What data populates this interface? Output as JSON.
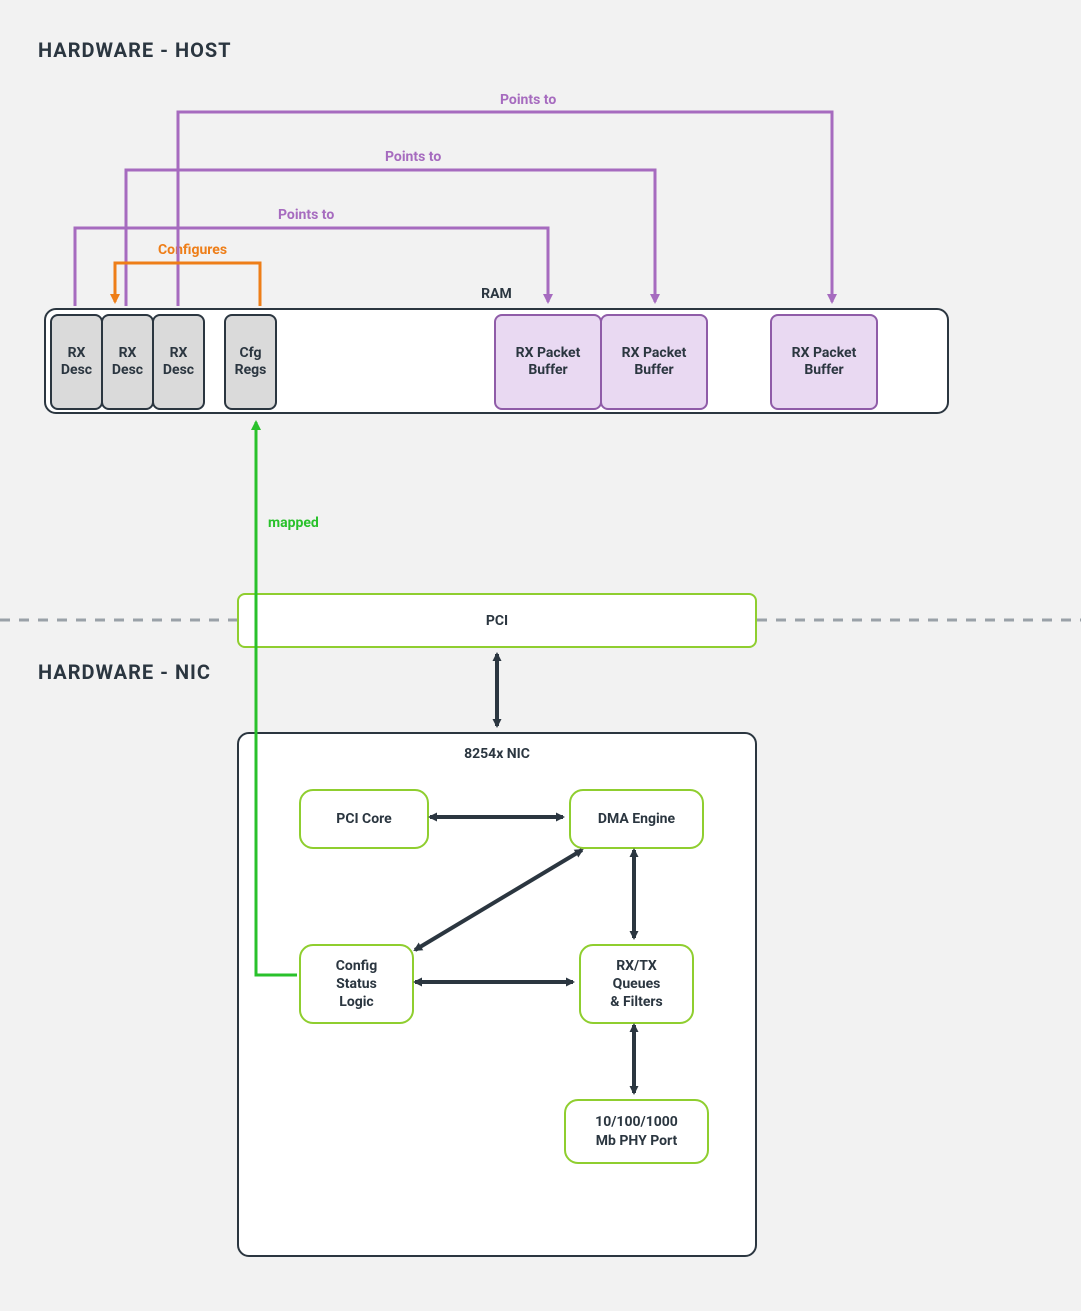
{
  "sections": {
    "host": "HARDWARE - HOST",
    "nic": "HARDWARE - NIC"
  },
  "ram": {
    "title": "RAM",
    "desc1": "RX\nDesc",
    "desc2": "RX\nDesc",
    "desc3": "RX\nDesc",
    "cfg": "Cfg\nRegs",
    "buf1": "RX Packet\nBuffer",
    "buf2": "RX Packet\nBuffer",
    "buf3": "RX Packet\nBuffer"
  },
  "pci": {
    "label": "PCI"
  },
  "nic": {
    "title": "8254x NIC",
    "pcicore": "PCI Core",
    "dma": "DMA Engine",
    "cfg": "Config\nStatus\nLogic",
    "queues": "RX/TX\nQueues\n& Filters",
    "phy": "10/100/1000\nMb PHY Port"
  },
  "edges": {
    "points_to": "Points to",
    "configures": "Configures",
    "mapped": "mapped"
  },
  "colors": {
    "stroke": "#2b3640",
    "purple": "#a66bbf",
    "orange": "#ee7e18",
    "green": "#29c12b",
    "lime": "#8fce2f"
  }
}
